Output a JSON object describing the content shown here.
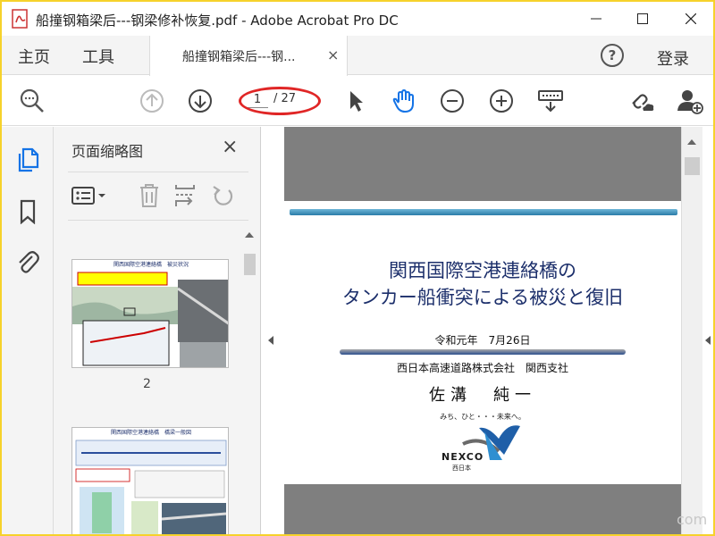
{
  "window": {
    "title": "船撞钢箱梁后---钢梁修补恢复.pdf - Adobe Acrobat Pro DC",
    "app_icon": "acrobat-pdf-icon",
    "controls": {
      "minimize": "minimize-icon",
      "maximize": "maximize-icon",
      "close": "close-icon"
    }
  },
  "nav": {
    "home": "主页",
    "tools": "工具",
    "document_tab": {
      "label": "船撞钢箱梁后---钢...",
      "close": "×"
    },
    "help": "?",
    "login": "登录"
  },
  "toolbar": {
    "page_current": "1",
    "page_total": "/ 27",
    "icons": [
      "search-icon",
      "previous-page-icon",
      "next-page-icon",
      "select-cursor-icon",
      "hand-tool-icon",
      "zoom-out-icon",
      "zoom-in-icon",
      "keyboard-icon",
      "share-link-icon",
      "add-user-icon"
    ],
    "accent": "#1473e6"
  },
  "rail": {
    "icons": [
      "page-thumbnails-icon",
      "bookmark-icon",
      "attachment-icon"
    ]
  },
  "thumbnails_panel": {
    "title": "页面缩略图",
    "close": "×",
    "tools": [
      "options-menu-icon",
      "delete-icon",
      "extract-icon",
      "rotate-icon"
    ],
    "thumbs": [
      {
        "label": "2",
        "header": "関西国際空港連絡橋　被災状況"
      },
      {
        "label": "",
        "header": "関西国際空港連絡橋　橋梁一般図"
      }
    ]
  },
  "document": {
    "title_line1": "関西国際空港連絡橋の",
    "title_line2": "タンカー船衝突による被災と復旧",
    "date": "令和元年　7月26日",
    "company": "西日本高速道路株式会社　関西支社",
    "author": "佐溝　純一",
    "slogan": "みち、ひと・・・未来へ。",
    "logo_text": "NEXCO",
    "logo_sub": "西日本"
  },
  "watermark": "com"
}
